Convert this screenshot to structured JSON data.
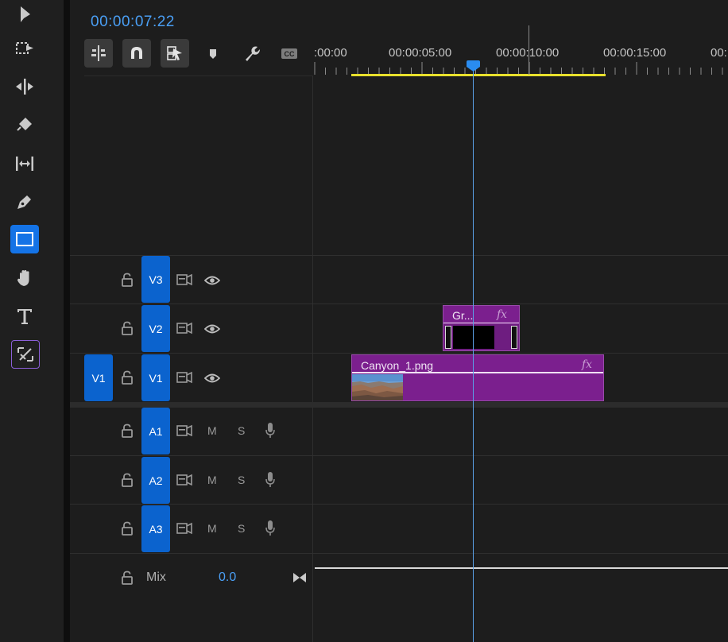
{
  "timecode": "00:00:07:22",
  "toolbar": {
    "tools": [
      {
        "name": "selection-tool",
        "icon": "arrow-icon"
      },
      {
        "name": "track-select-tool",
        "icon": "track-select-icon"
      },
      {
        "name": "ripple-edit-tool",
        "icon": "ripple-edit-icon"
      },
      {
        "name": "razor-tool",
        "icon": "razor-icon"
      },
      {
        "name": "slip-tool",
        "icon": "slip-icon"
      },
      {
        "name": "pen-tool",
        "icon": "pen-icon"
      },
      {
        "name": "rectangle-tool",
        "icon": "rectangle-icon",
        "active": true
      },
      {
        "name": "hand-tool",
        "icon": "hand-icon"
      },
      {
        "name": "type-tool",
        "icon": "type-icon"
      },
      {
        "name": "remix-tool",
        "icon": "remix-icon"
      }
    ]
  },
  "header_buttons": [
    {
      "name": "insert-sequence-nest-button",
      "icon": "nest-icon"
    },
    {
      "name": "snap-button",
      "icon": "magnet-icon"
    },
    {
      "name": "linked-selection-button",
      "icon": "linked-selection-icon"
    },
    {
      "name": "add-marker-button",
      "icon": "marker-icon"
    },
    {
      "name": "timeline-settings-button",
      "icon": "wrench-icon"
    },
    {
      "name": "captions-button",
      "icon": "cc-icon"
    }
  ],
  "ruler": {
    "labels": [
      ":00:00",
      "00:00:05:00",
      "00:00:10:00",
      "00:00:15:00",
      "00:"
    ]
  },
  "tracks": {
    "video": [
      {
        "label": "V3"
      },
      {
        "label": "V2"
      },
      {
        "label": "V1"
      }
    ],
    "audio": [
      {
        "label": "A1",
        "mute": "M",
        "solo": "S"
      },
      {
        "label": "A2",
        "mute": "M",
        "solo": "S"
      },
      {
        "label": "A3",
        "mute": "M",
        "solo": "S"
      }
    ],
    "source_patch": "V1",
    "mix": {
      "label": "Mix",
      "value": "0.0"
    }
  },
  "clips": {
    "graphic": {
      "name": "Gr...",
      "fx": "fx"
    },
    "canyon": {
      "name": "Canyon_1.png",
      "fx": "fx"
    }
  },
  "colors": {
    "accent": "#1473e6",
    "timecode": "#4a9ff5",
    "clip": "#7b1f8e",
    "work_area": "#e8e02c"
  }
}
